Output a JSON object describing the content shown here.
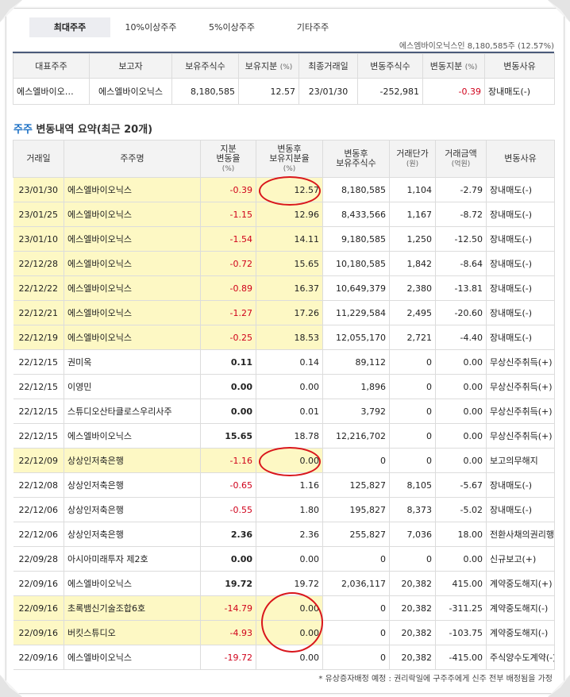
{
  "tabs": [
    "최대주주",
    "10%이상주주",
    "5%이상주주",
    "기타주주"
  ],
  "holder_summary": "에스엠바이오닉스인 8,180,585주 (12.57%)",
  "major_table": {
    "headers": [
      "대표주주",
      "보고자",
      "보유주식수",
      "보유지분",
      "(%)",
      "최종거래일",
      "변동주식수",
      "변동지분",
      "(%)",
      "변동사유"
    ],
    "row": [
      "에스엘바이오…",
      "에스엘바이오닉스",
      "8,180,585",
      "12.57",
      "23/01/30",
      "-252,981",
      "-0.39",
      "장내매도(-)"
    ]
  },
  "section_title_accent": "주주",
  "section_title_rest": " 변동내역 요약(최근 20개)",
  "history_headers": {
    "date": "거래일",
    "name": "주주명",
    "change_pct": [
      "지분",
      "변동율",
      "(%)"
    ],
    "after_pct": [
      "변동후",
      "보유지분율",
      "(%)"
    ],
    "after_shares": [
      "변동후",
      "보유주식수"
    ],
    "price": [
      "거래단가",
      "(원)"
    ],
    "amount": [
      "거래금액",
      "(억원)"
    ],
    "reason": "변동사유"
  },
  "history_rows": [
    {
      "date": "23/01/30",
      "name": "에스엘바이오닉스",
      "chg": "-0.39",
      "after": "12.57",
      "shares": "8,180,585",
      "price": "1,104",
      "amount": "-2.79",
      "reason": "장내매도(-)",
      "hl": true,
      "bold": false
    },
    {
      "date": "23/01/25",
      "name": "에스엘바이오닉스",
      "chg": "-1.15",
      "after": "12.96",
      "shares": "8,433,566",
      "price": "1,167",
      "amount": "-8.72",
      "reason": "장내매도(-)",
      "hl": true,
      "bold": false
    },
    {
      "date": "23/01/10",
      "name": "에스엘바이오닉스",
      "chg": "-1.54",
      "after": "14.11",
      "shares": "9,180,585",
      "price": "1,250",
      "amount": "-12.50",
      "reason": "장내매도(-)",
      "hl": true,
      "bold": false
    },
    {
      "date": "22/12/28",
      "name": "에스엘바이오닉스",
      "chg": "-0.72",
      "after": "15.65",
      "shares": "10,180,585",
      "price": "1,842",
      "amount": "-8.64",
      "reason": "장내매도(-)",
      "hl": true,
      "bold": false
    },
    {
      "date": "22/12/22",
      "name": "에스엘바이오닉스",
      "chg": "-0.89",
      "after": "16.37",
      "shares": "10,649,379",
      "price": "2,380",
      "amount": "-13.81",
      "reason": "장내매도(-)",
      "hl": true,
      "bold": false
    },
    {
      "date": "22/12/21",
      "name": "에스엘바이오닉스",
      "chg": "-1.27",
      "after": "17.26",
      "shares": "11,229,584",
      "price": "2,495",
      "amount": "-20.60",
      "reason": "장내매도(-)",
      "hl": true,
      "bold": false
    },
    {
      "date": "22/12/19",
      "name": "에스엘바이오닉스",
      "chg": "-0.25",
      "after": "18.53",
      "shares": "12,055,170",
      "price": "2,721",
      "amount": "-4.40",
      "reason": "장내매도(-)",
      "hl": true,
      "bold": false
    },
    {
      "date": "22/12/15",
      "name": "권미옥",
      "chg": "0.11",
      "after": "0.14",
      "shares": "89,112",
      "price": "0",
      "amount": "0.00",
      "reason": "무상신주취득(+)",
      "hl": false,
      "bold": true
    },
    {
      "date": "22/12/15",
      "name": "이영민",
      "chg": "0.00",
      "after": "0.00",
      "shares": "1,896",
      "price": "0",
      "amount": "0.00",
      "reason": "무상신주취득(+)",
      "hl": false,
      "bold": true
    },
    {
      "date": "22/12/15",
      "name": "스튜디오산타클로스우리사주",
      "chg": "0.00",
      "after": "0.01",
      "shares": "3,792",
      "price": "0",
      "amount": "0.00",
      "reason": "무상신주취득(+)",
      "hl": false,
      "bold": true
    },
    {
      "date": "22/12/15",
      "name": "에스엘바이오닉스",
      "chg": "15.65",
      "after": "18.78",
      "shares": "12,216,702",
      "price": "0",
      "amount": "0.00",
      "reason": "무상신주취득(+)",
      "hl": false,
      "bold": true
    },
    {
      "date": "22/12/09",
      "name": "상상인저축은행",
      "chg": "-1.16",
      "after": "0.00",
      "shares": "0",
      "price": "0",
      "amount": "0.00",
      "reason": "보고의무해지",
      "hl": true,
      "bold": false
    },
    {
      "date": "22/12/08",
      "name": "상상인저축은행",
      "chg": "-0.65",
      "after": "1.16",
      "shares": "125,827",
      "price": "8,105",
      "amount": "-5.67",
      "reason": "장내매도(-)",
      "hl": false,
      "bold": false
    },
    {
      "date": "22/12/06",
      "name": "상상인저축은행",
      "chg": "-0.55",
      "after": "1.80",
      "shares": "195,827",
      "price": "8,373",
      "amount": "-5.02",
      "reason": "장내매도(-)",
      "hl": false,
      "bold": false
    },
    {
      "date": "22/12/06",
      "name": "상상인저축은행",
      "chg": "2.36",
      "after": "2.36",
      "shares": "255,827",
      "price": "7,036",
      "amount": "18.00",
      "reason": "전환사채의권리행",
      "hl": false,
      "bold": true
    },
    {
      "date": "22/09/28",
      "name": "아시아미래투자 제2호",
      "chg": "0.00",
      "after": "0.00",
      "shares": "0",
      "price": "0",
      "amount": "0.00",
      "reason": "신규보고(+)",
      "hl": false,
      "bold": true
    },
    {
      "date": "22/09/16",
      "name": "에스엘바이오닉스",
      "chg": "19.72",
      "after": "19.72",
      "shares": "2,036,117",
      "price": "20,382",
      "amount": "415.00",
      "reason": "계약중도해지(+)",
      "hl": false,
      "bold": true
    },
    {
      "date": "22/09/16",
      "name": "초록뱀신기술조합6호",
      "chg": "-14.79",
      "after": "0.00",
      "shares": "0",
      "price": "20,382",
      "amount": "-311.25",
      "reason": "계약중도해지(-)",
      "hl": true,
      "bold": false
    },
    {
      "date": "22/09/16",
      "name": "버킷스튜디오",
      "chg": "-4.93",
      "after": "0.00",
      "shares": "0",
      "price": "20,382",
      "amount": "-103.75",
      "reason": "계약중도해지(-)",
      "hl": true,
      "bold": false
    },
    {
      "date": "22/09/16",
      "name": "에스엘바이오닉스",
      "chg": "-19.72",
      "after": "0.00",
      "shares": "0",
      "price": "20,382",
      "amount": "-415.00",
      "reason": "주식양수도계약(-)",
      "hl": false,
      "bold": false
    }
  ],
  "footnote": "* 유상증자배정 예정 : 권리락일에 구주주에게 신주 전부 배정됨을 가정",
  "colors": {
    "highlight": "#fdf8c4",
    "negative": "#d0021b",
    "accent": "#1a6fc4",
    "circle": "#d9161c"
  }
}
